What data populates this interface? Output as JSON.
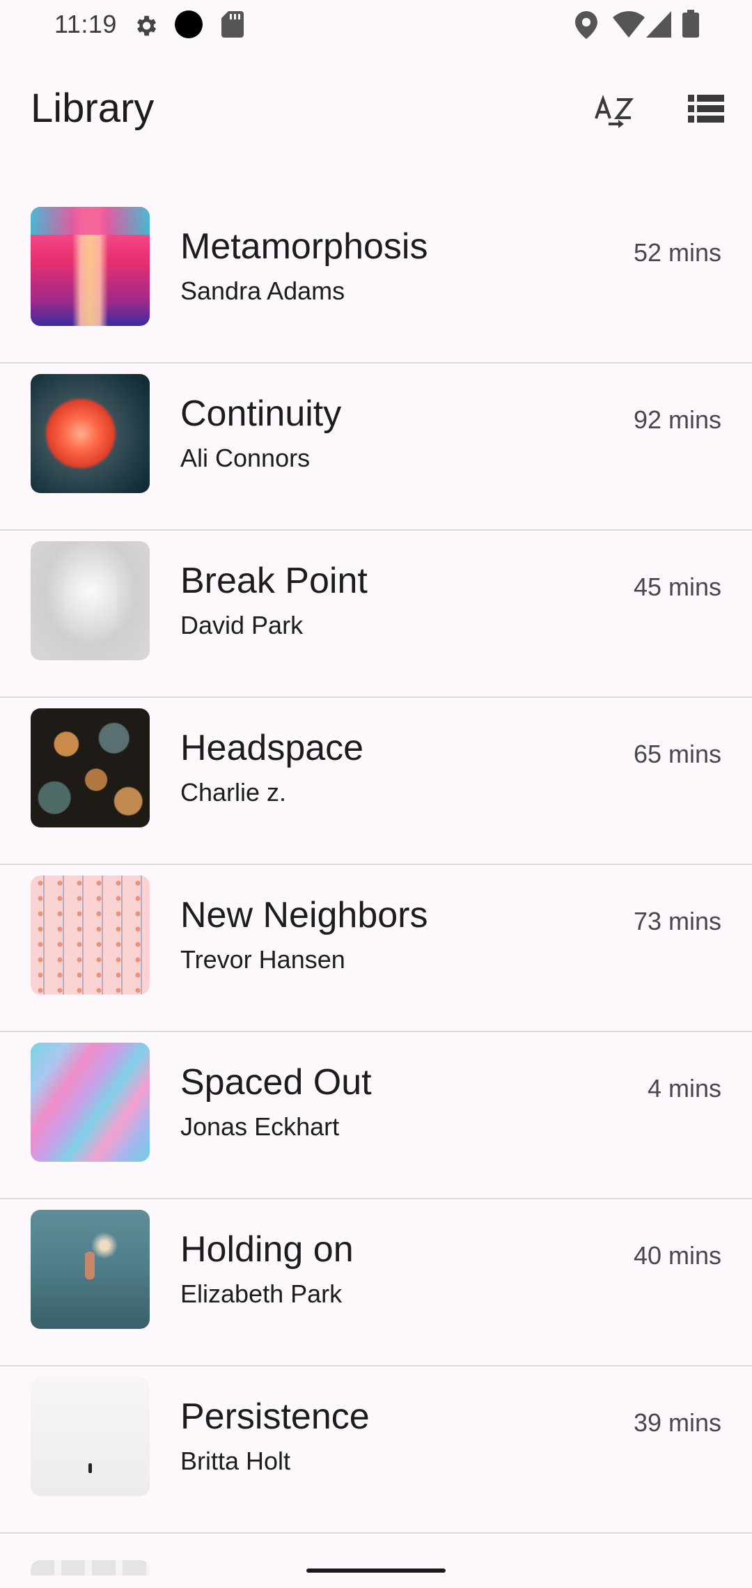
{
  "status_bar": {
    "time": "11:19",
    "left_icons": [
      "settings-icon",
      "dot-icon",
      "sd-card-icon"
    ],
    "right_icons": [
      "location-icon",
      "wifi-icon",
      "signal-icon",
      "battery-icon"
    ]
  },
  "app_bar": {
    "title": "Library",
    "actions": [
      "sort-az-icon",
      "view-list-icon"
    ]
  },
  "items": [
    {
      "title": "Metamorphosis",
      "subtitle": "Sandra Adams",
      "duration": "52 mins"
    },
    {
      "title": "Continuity",
      "subtitle": "Ali Connors",
      "duration": "92 mins"
    },
    {
      "title": "Break Point",
      "subtitle": "David Park",
      "duration": "45 mins"
    },
    {
      "title": "Headspace",
      "subtitle": "Charlie z.",
      "duration": "65 mins"
    },
    {
      "title": "New Neighbors",
      "subtitle": "Trevor Hansen",
      "duration": "73 mins"
    },
    {
      "title": "Spaced Out",
      "subtitle": "Jonas Eckhart",
      "duration": "4 mins"
    },
    {
      "title": "Holding on",
      "subtitle": "Elizabeth Park",
      "duration": "40 mins"
    },
    {
      "title": "Persistence",
      "subtitle": "Britta Holt",
      "duration": "39 mins"
    }
  ]
}
